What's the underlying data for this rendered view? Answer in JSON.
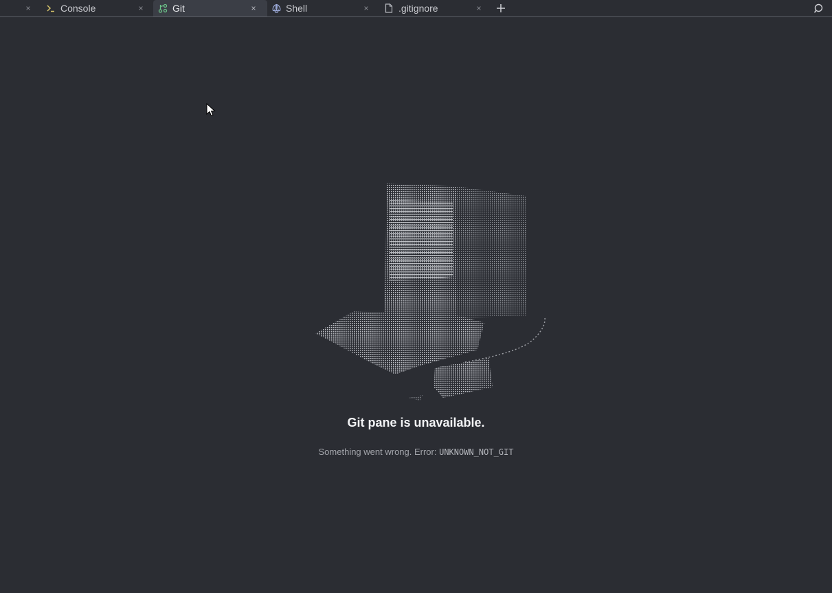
{
  "tabs": [
    {
      "label": "Console",
      "icon": "terminal-icon",
      "active": false
    },
    {
      "label": "Git",
      "icon": "git-branch-icon",
      "active": true
    },
    {
      "label": "Shell",
      "icon": "shell-icon",
      "active": false
    },
    {
      "label": ".gitignore",
      "icon": "file-icon",
      "active": false
    }
  ],
  "toolbar": {
    "close_glyph": "×",
    "add_tab_glyph": "+",
    "search_icon": "search-icon"
  },
  "error": {
    "title": "Git pane is unavailable.",
    "message": "Something went wrong. Error: ",
    "code": "UNKNOWN_NOT_GIT"
  },
  "colors": {
    "background": "#2b2d33",
    "active_tab": "#3b3e46",
    "console_icon": "#d4c26a",
    "git_icon": "#6cc48a",
    "shell_icon": "#9aa8d6"
  }
}
